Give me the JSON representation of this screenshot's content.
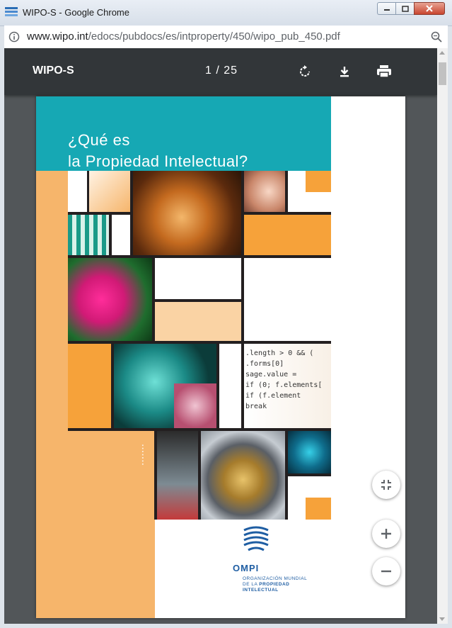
{
  "window": {
    "title": "WIPO-S - Google Chrome",
    "icon": "wipo-app-icon"
  },
  "address_bar": {
    "host": "www.wipo.int",
    "path": "/edocs/pubdocs/es/intproperty/450/wipo_pub_450.pdf"
  },
  "pdf_toolbar": {
    "title": "WIPO-S",
    "current_page": "1",
    "separator": "/",
    "total_pages": "25"
  },
  "cover": {
    "title_line1": "¿Qué es",
    "title_line2": "la Propiedad Intelectual?",
    "org_short": "OMPI",
    "org_line1": "ORGANIZACIÓN MUNDIAL",
    "org_line2_prefix": "DE LA ",
    "org_line2_bold": "PROPIEDAD",
    "org_line3": "INTELECTUAL",
    "code_text": ".length > 0 && (\n.forms[0]\nsage.value =\nif (0; f.elements[\nif (f.element\nbreak",
    "colors": {
      "teal": "#16a8b4",
      "orange": "#f6a23a",
      "light_orange": "#fad3a4",
      "dark": "#231f20"
    }
  },
  "controls": {
    "fit_icon": "fit-to-page-icon",
    "zoom_in_icon": "zoom-in-icon",
    "zoom_out_icon": "zoom-out-icon"
  }
}
